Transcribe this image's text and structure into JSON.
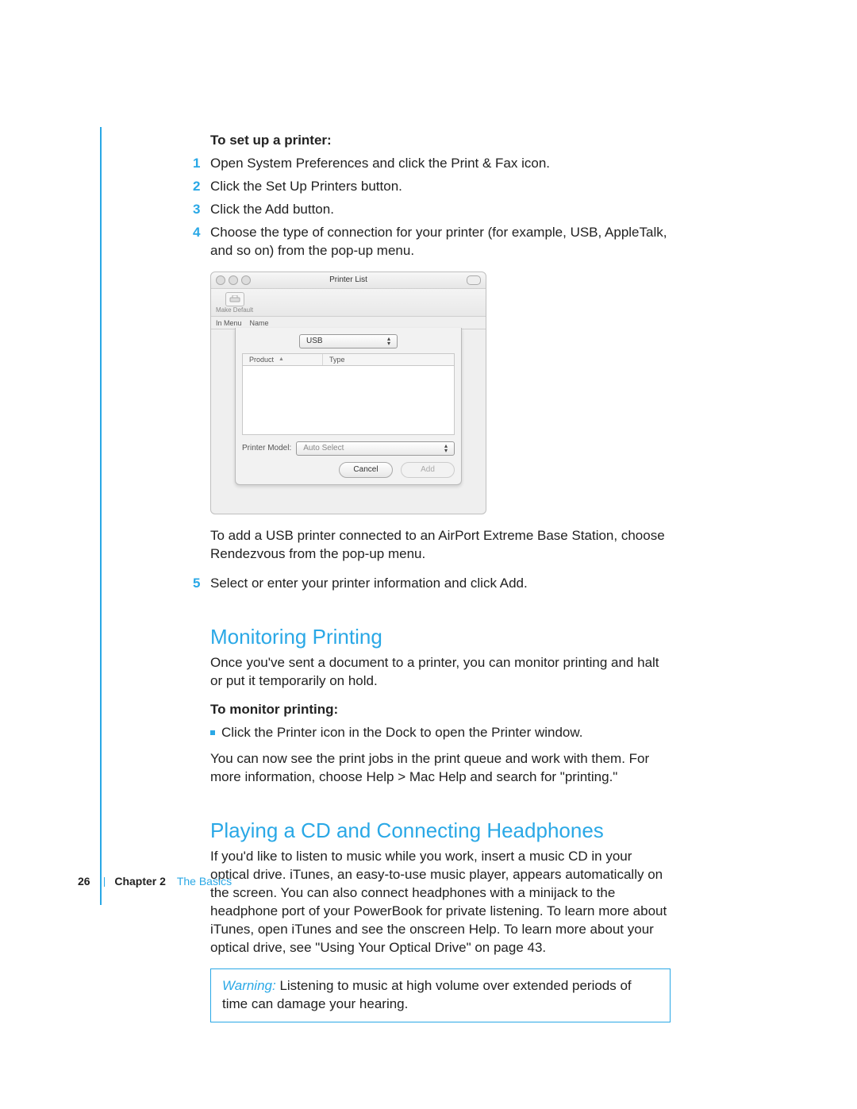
{
  "setup": {
    "heading": "To set up a printer:",
    "steps": [
      "Open System Preferences and click the Print & Fax icon.",
      "Click the Set Up Printers button.",
      "Click the Add button.",
      "Choose the type of connection for your printer (for example, USB, AppleTalk, and so on) from the pop-up menu."
    ],
    "after_shot": "To add a USB printer connected to an AirPort Extreme Base Station, choose Rendezvous from the pop-up menu.",
    "step5": "Select or enter your printer information and click Add."
  },
  "dialog": {
    "window_title": "Printer List",
    "toolbar_btn": "Make Default",
    "tabs": [
      "In Menu",
      "Name"
    ],
    "connection_dropdown": "USB",
    "col_product": "Product",
    "col_type": "Type",
    "model_label": "Printer Model:",
    "model_value": "Auto Select",
    "cancel": "Cancel",
    "add": "Add"
  },
  "monitor": {
    "title": "Monitoring Printing",
    "intro": "Once you've sent a document to a printer, you can monitor printing and halt or put it temporarily on hold.",
    "sub": "To monitor printing:",
    "bullet": "Click the Printer icon in the Dock to open the Printer window.",
    "after": "You can now see the print jobs in the print queue and work with them. For more information, choose Help > Mac Help and search for \"printing.\""
  },
  "cd": {
    "title": "Playing a CD and Connecting Headphones",
    "body": "If you'd like to listen to music while you work, insert a music CD in your optical drive. iTunes, an easy-to-use music player, appears automatically on the screen. You can also connect headphones with a minijack to the headphone port of your PowerBook for private listening. To learn more about iTunes, open iTunes and see the onscreen Help. To learn more about your optical drive, see \"Using Your Optical Drive\" on page 43.",
    "warning_label": "Warning:",
    "warning": "Listening to music at high volume over extended periods of time can damage your hearing."
  },
  "footer": {
    "page": "26",
    "chapter": "Chapter 2",
    "chapter_name": "The Basics"
  }
}
